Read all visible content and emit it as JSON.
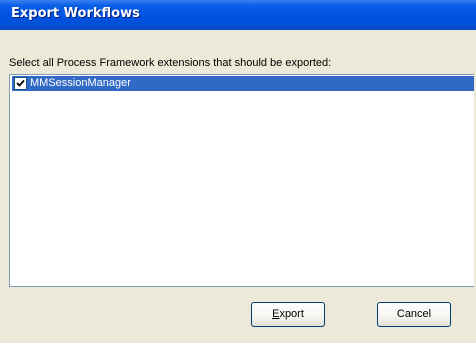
{
  "window": {
    "title": "Export Workflows"
  },
  "dialog": {
    "instruction": "Select all Process Framework extensions that should be exported:",
    "items": [
      {
        "label": "MMSessionManager",
        "checked": true,
        "selected": true
      }
    ]
  },
  "buttons": {
    "export_mnemonic": "E",
    "export_rest": "xport",
    "cancel_label": "Cancel"
  },
  "colors": {
    "titlebar": "#0054e3",
    "dialog_bg": "#ece9d8",
    "selection": "#316ac5"
  }
}
